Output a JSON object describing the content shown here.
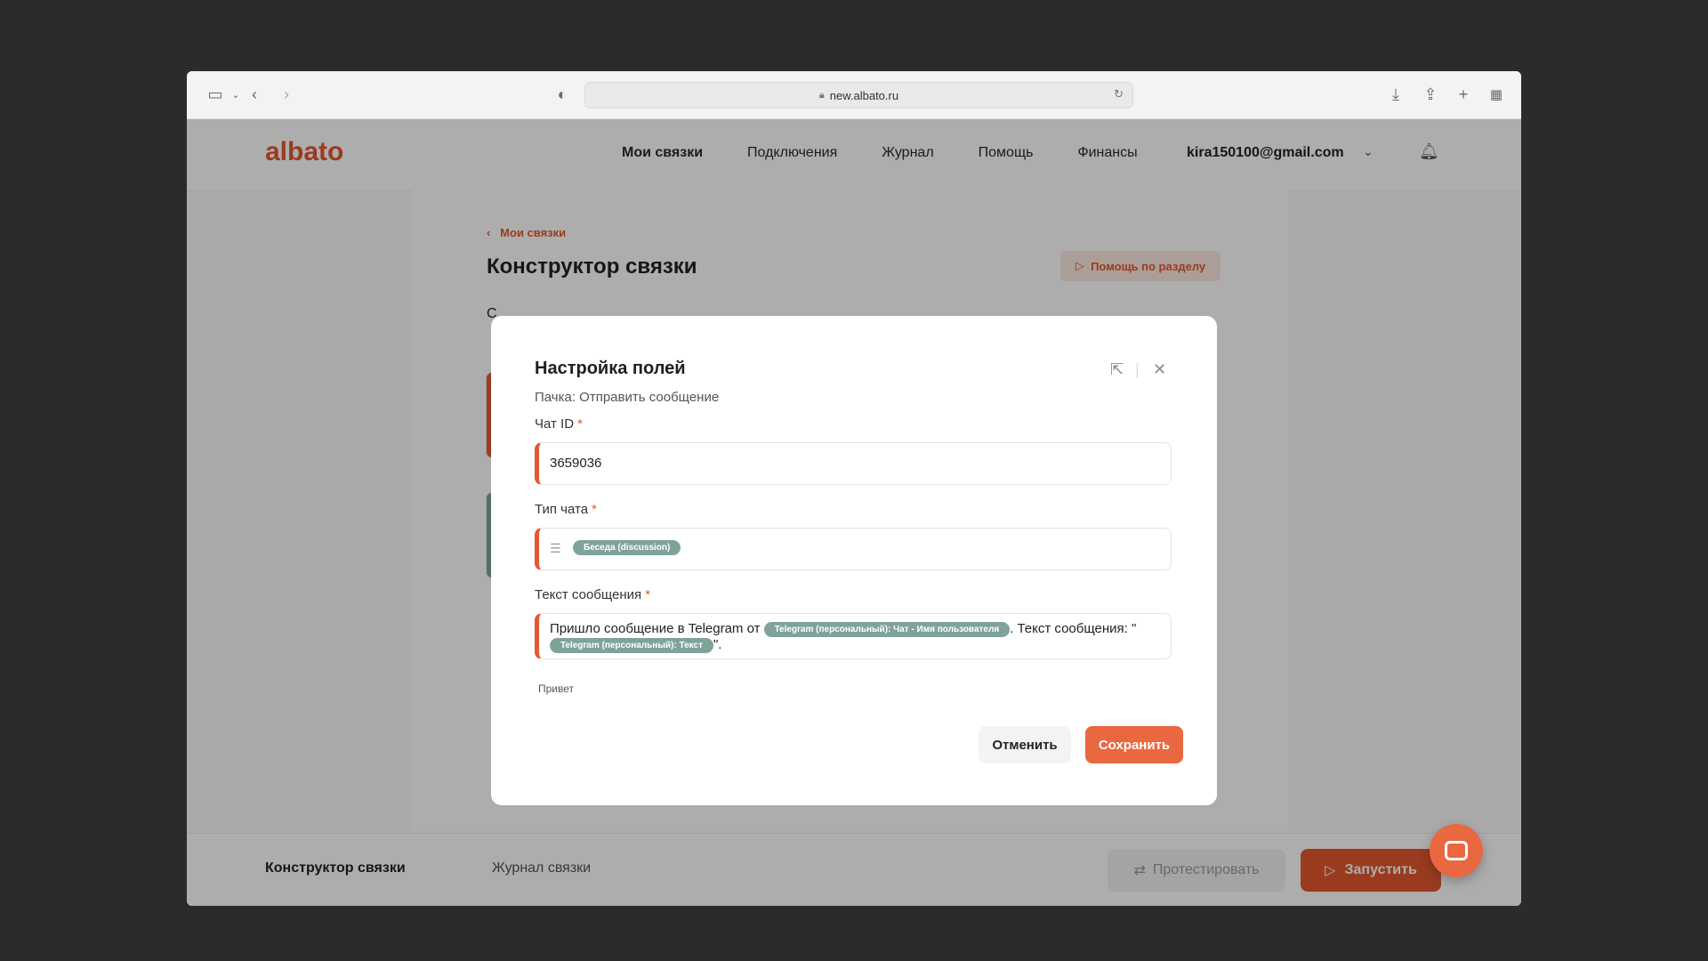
{
  "browser": {
    "address": "new.albato.ru"
  },
  "header": {
    "logo": "albato",
    "nav": [
      "Мои связки",
      "Подключения",
      "Журнал",
      "Помощь",
      "Финансы"
    ],
    "user_email": "kira150100@gmail.com"
  },
  "background_page": {
    "back_link": "Мои связки",
    "title": "Конструктор связки",
    "help_button": "Помощь по разделу",
    "left_letter": "С"
  },
  "footer": {
    "tabs": [
      "Конструктор связки",
      "Журнал связки"
    ],
    "test_button": "Протестировать",
    "run_button": "Запустить"
  },
  "modal": {
    "title": "Настройка полей",
    "subtitle": "Пачка: Отправить сообщение",
    "fields": {
      "chat_id": {
        "label": "Чат ID",
        "required_mark": "*",
        "value": "3659036"
      },
      "chat_type": {
        "label": "Тип чата",
        "required_mark": "*",
        "chip": "Беседа (discussion)"
      },
      "message_text": {
        "label": "Текст сообщения",
        "required_mark": "*",
        "text_part1": "Пришло сообщение в Telegram от",
        "chip1": "Telegram (персональный): Чат - Имя пользователя",
        "text_part2": ". Текст сообщения: \"",
        "chip2": "Telegram (персональный): Текст",
        "text_part3": "\".",
        "hint": "Привет"
      }
    },
    "cancel_button": "Отменить",
    "save_button": "Сохранить"
  },
  "colors": {
    "accent": "#e4582e",
    "chip": "#7fa39b"
  }
}
